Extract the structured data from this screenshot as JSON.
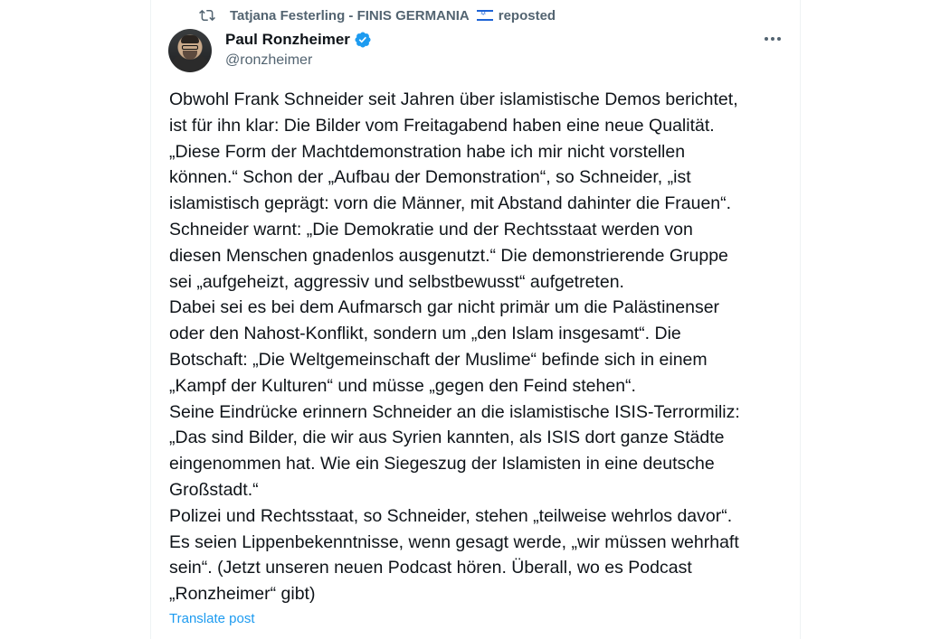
{
  "repost": {
    "text": "Tatjana Festerling - FINIS GERMANIA",
    "flag_icon": "israel-flag-emoji",
    "suffix": "reposted"
  },
  "author": {
    "name": "Paul Ronzheimer",
    "handle": "@ronzheimer",
    "verified": true
  },
  "post": {
    "lines": [
      "Obwohl Frank Schneider seit Jahren über islamistische Demos berichtet,",
      "ist für ihn klar: Die Bilder vom Freitagabend haben eine neue Qualität.",
      "„Diese Form der Machtdemonstration habe ich mir nicht vorstellen",
      "können.“ Schon der „Aufbau der Demonstration“, so Schneider, „ist",
      "islamistisch geprägt: vorn die Männer, mit Abstand dahinter die Frauen“.",
      "Schneider warnt: „Die Demokratie und der Rechtsstaat werden von",
      "diesen Menschen gnadenlos ausgenutzt.“ Die demonstrierende Gruppe",
      "sei „aufgeheizt, aggressiv und selbstbewusst“ aufgetreten.",
      "Dabei sei es bei dem Aufmarsch gar nicht primär um die Palästinenser",
      "oder den Nahost-Konflikt, sondern um „den Islam insgesamt“. Die",
      "Botschaft: „Die Weltgemeinschaft der Muslime“ befinde sich in einem",
      "„Kampf der Kulturen“ und müsse „gegen den Feind stehen“.",
      "Seine Eindrücke erinnern Schneider an die islamistische ISIS-Terrormiliz:",
      "„Das sind Bilder, die wir aus Syrien kannten, als ISIS dort ganze Städte",
      "eingenommen hat. Wie ein Siegeszug der Islamisten in eine deutsche",
      "Großstadt.“",
      "Polizei und Rechtsstaat, so Schneider, stehen „teilweise wehrlos davor“.",
      "Es seien Lippenbekenntnisse, wenn gesagt werde, „wir müssen wehrhaft",
      "sein“. (Jetzt unseren neuen Podcast hören. Überall, wo es Podcast",
      "„Ronzheimer“ gibt)"
    ]
  },
  "translate_label": "Translate post",
  "colors": {
    "text": "#0f1419",
    "secondary": "#536471",
    "accent": "#1d9bf0"
  }
}
